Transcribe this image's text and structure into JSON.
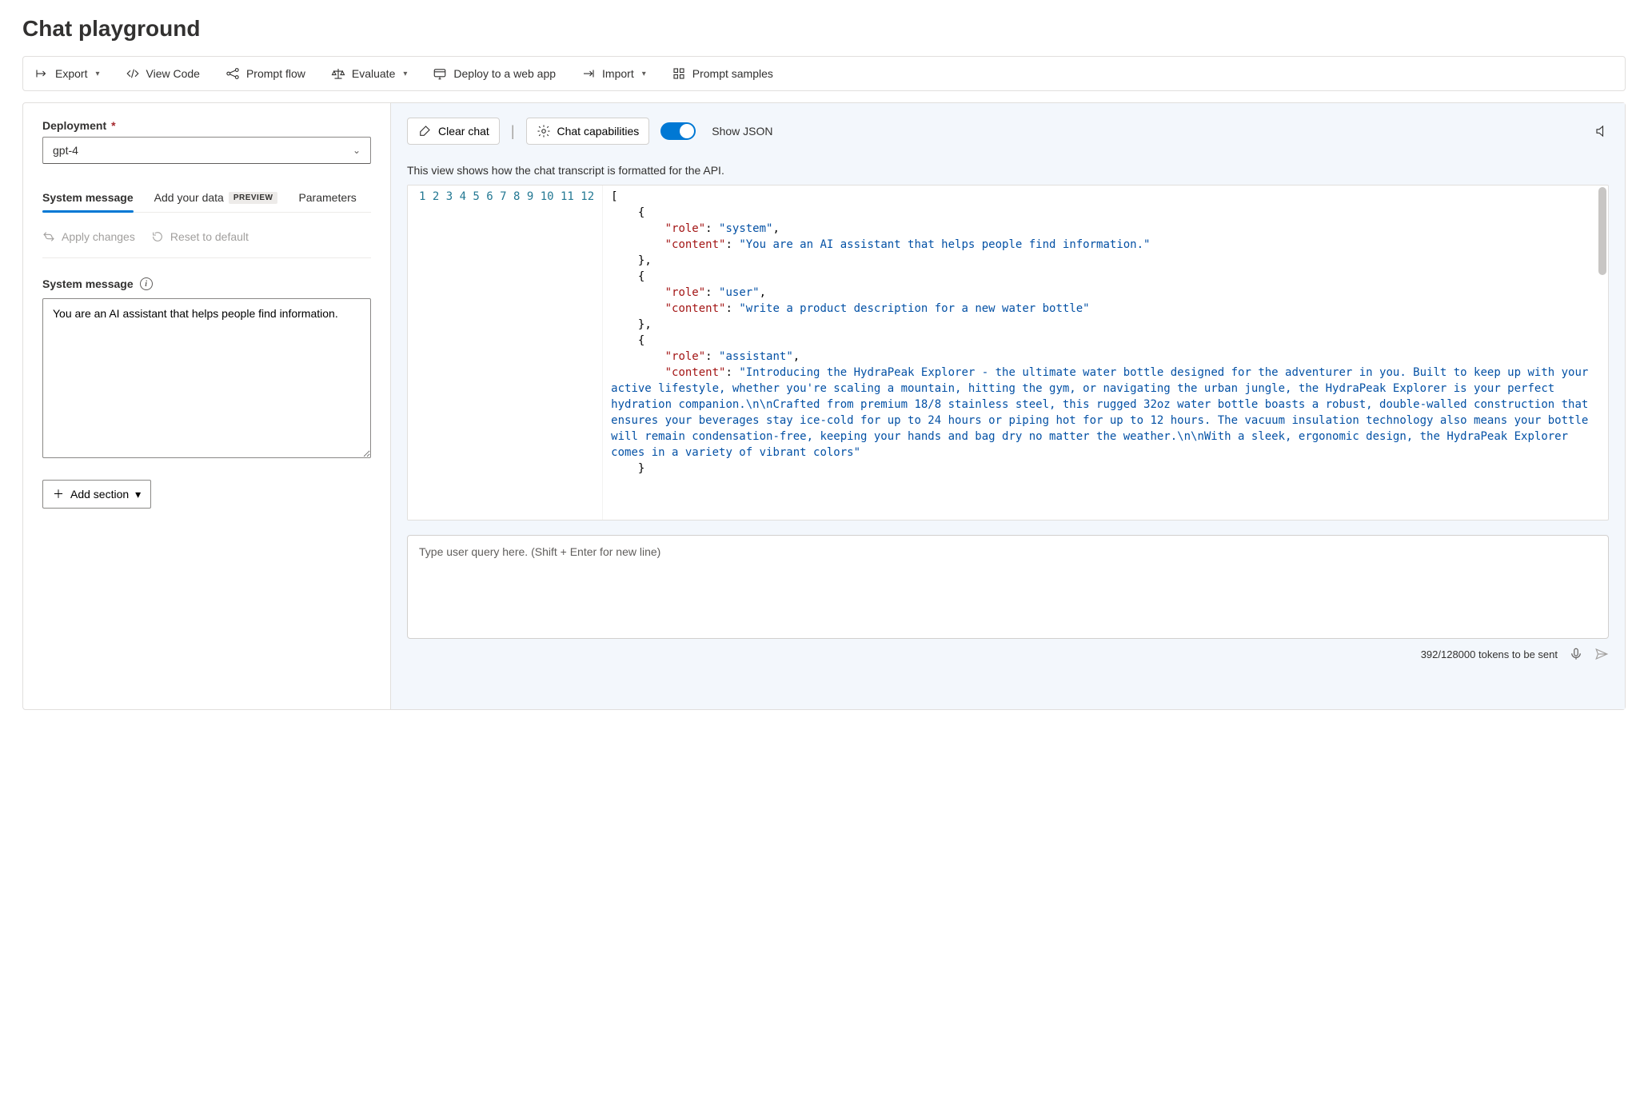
{
  "page": {
    "title": "Chat playground"
  },
  "toolbar": {
    "export": "Export",
    "view_code": "View Code",
    "prompt_flow": "Prompt flow",
    "evaluate": "Evaluate",
    "deploy": "Deploy to a web app",
    "import": "Import",
    "prompt_samples": "Prompt samples"
  },
  "left": {
    "deployment_label": "Deployment",
    "deployment_value": "gpt-4",
    "tabs": {
      "system_message": "System message",
      "add_your_data": "Add your data",
      "add_your_data_badge": "PREVIEW",
      "parameters": "Parameters"
    },
    "apply_changes": "Apply changes",
    "reset_default": "Reset to default",
    "system_message_label": "System message",
    "system_message_value": "You are an AI assistant that helps people find information.",
    "add_section": "Add section"
  },
  "right": {
    "clear_chat": "Clear chat",
    "chat_capabilities": "Chat capabilities",
    "show_json": "Show JSON",
    "show_json_on": true,
    "api_note": "This view shows how the chat transcript is formatted for the API.",
    "transcript": [
      {
        "role": "system",
        "content": "You are an AI assistant that helps people find information."
      },
      {
        "role": "user",
        "content": "write a product description for a new water bottle"
      },
      {
        "role": "assistant",
        "content": "Introducing the HydraPeak Explorer - the ultimate water bottle designed for the adventurer in you. Built to keep up with your active lifestyle, whether you're scaling a mountain, hitting the gym, or navigating the urban jungle, the HydraPeak Explorer is your perfect hydration companion.\\n\\nCrafted from premium 18/8 stainless steel, this rugged 32oz water bottle boasts a robust, double-walled construction that ensures your beverages stay ice-cold for up to 24 hours or piping hot for up to 12 hours. The vacuum insulation technology also means your bottle will remain condensation-free, keeping your hands and bag dry no matter the weather.\\n\\nWith a sleek, ergonomic design, the HydraPeak Explorer comes in a variety of vibrant colors"
      }
    ],
    "line_count": 12,
    "input_placeholder": "Type user query here. (Shift + Enter for new line)",
    "tokens_text": "392/128000 tokens to be sent"
  }
}
